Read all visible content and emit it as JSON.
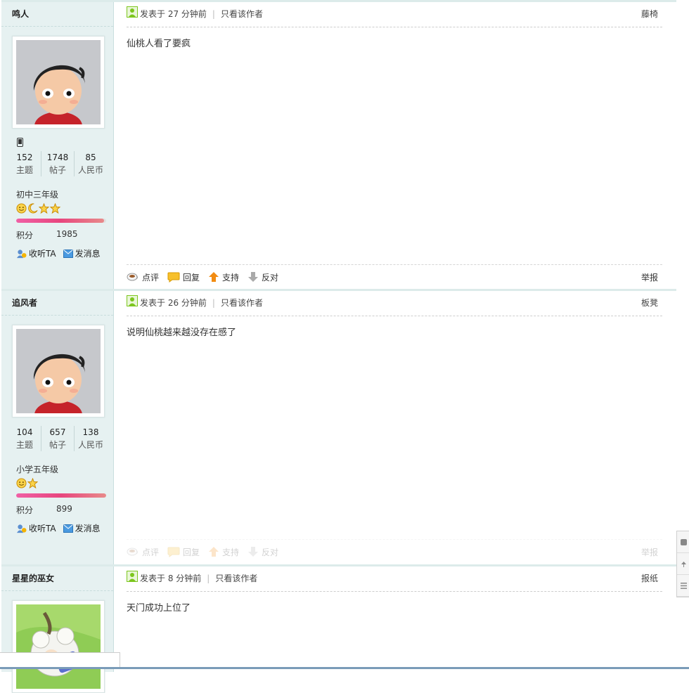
{
  "posts": [
    {
      "author": "鸣人",
      "has_mobile_icon": true,
      "stats": [
        {
          "value": "152",
          "label": "主题"
        },
        {
          "value": "1748",
          "label": "帖子"
        },
        {
          "value": "85",
          "label": "人民币"
        }
      ],
      "level": "初中三年级",
      "level_icons": [
        "smile-icon",
        "moon-icon",
        "star-icon",
        "star-icon"
      ],
      "progress": 0.98,
      "score_label": "积分",
      "score": "1985",
      "follow_label": "收听TA",
      "message_label": "发消息",
      "posted": "发表于 27 分钟前",
      "author_only": "只看该作者",
      "floor": "藤椅",
      "content": "仙桃人看了要疯",
      "actions": {
        "comment": "点评",
        "reply": "回复",
        "support": "支持",
        "oppose": "反对",
        "report": "举报"
      }
    },
    {
      "author": "追风者",
      "has_mobile_icon": false,
      "stats": [
        {
          "value": "104",
          "label": "主题"
        },
        {
          "value": "657",
          "label": "帖子"
        },
        {
          "value": "138",
          "label": "人民币"
        }
      ],
      "level": "小学五年级",
      "level_icons": [
        "smile-icon",
        "star-icon"
      ],
      "progress": 1.0,
      "score_label": "积分",
      "score": "899",
      "follow_label": "收听TA",
      "message_label": "发消息",
      "posted": "发表于 26 分钟前",
      "author_only": "只看该作者",
      "floor": "板凳",
      "content": "说明仙桃越来越没存在感了",
      "actions": {
        "comment": "点评",
        "reply": "回复",
        "support": "支持",
        "oppose": "反对",
        "report": "举报"
      }
    },
    {
      "author": "星星的巫女",
      "posted": "发表于 8 分钟前",
      "author_only": "只看该作者",
      "floor": "报纸",
      "content": "天门成功上位了"
    }
  ],
  "colors": {
    "sidebar_bg": "#e6f1f1",
    "bar_pink": "#e8467e",
    "star_gold": "#f5b400",
    "post_icon_green": "#7cc61e"
  }
}
